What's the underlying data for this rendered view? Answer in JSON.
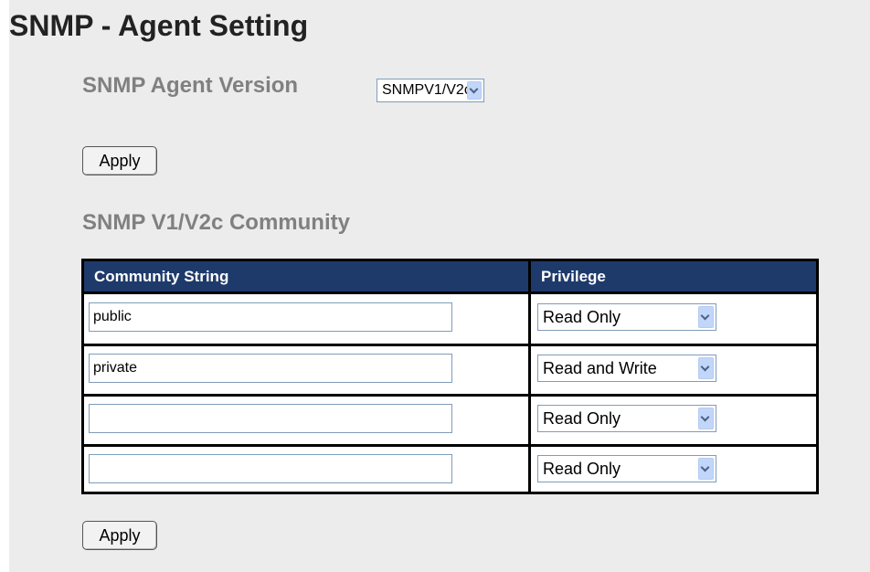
{
  "page": {
    "title": "SNMP - Agent Setting"
  },
  "agent": {
    "version_label": "SNMP Agent Version",
    "version_value": "SNMPV1/V2c",
    "apply_label": "Apply"
  },
  "community": {
    "section_title": "SNMP V1/V2c Community",
    "columns": [
      "Community String",
      "Privilege"
    ],
    "rows": [
      {
        "community": "public",
        "privilege": "Read Only"
      },
      {
        "community": "private",
        "privilege": "Read and Write"
      },
      {
        "community": "",
        "privilege": "Read Only"
      },
      {
        "community": "",
        "privilege": "Read Only"
      }
    ],
    "apply_label": "Apply"
  },
  "colors": {
    "table_header_bg": "#1e3a6a",
    "panel_bg": "#ececec",
    "label_gray": "#808080"
  }
}
